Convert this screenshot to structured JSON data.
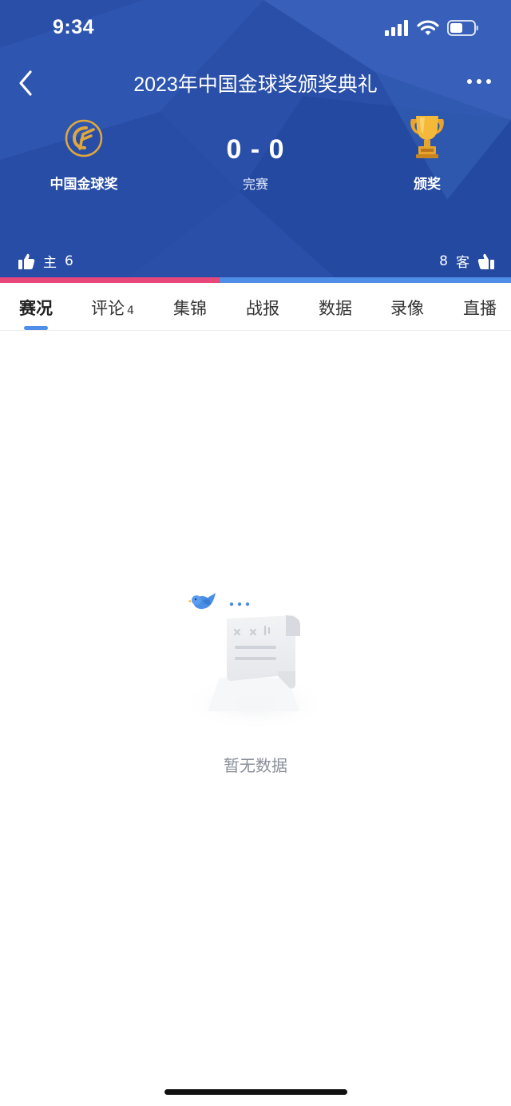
{
  "status_bar": {
    "time": "9:34"
  },
  "nav": {
    "title": "2023年中国金球奖颁奖典礼"
  },
  "match": {
    "home_team": "中国金球奖",
    "away_team": "颁奖",
    "score": "0 - 0",
    "status": "完赛"
  },
  "support": {
    "home_label": "主",
    "home_count": "6",
    "away_label": "客",
    "away_count": "8",
    "home_share": 0.43
  },
  "tabs": [
    {
      "label": "赛况",
      "active": true
    },
    {
      "label": "评论",
      "badge": "4"
    },
    {
      "label": "集锦"
    },
    {
      "label": "战报"
    },
    {
      "label": "数据"
    },
    {
      "label": "录像"
    },
    {
      "label": "直播"
    }
  ],
  "empty_state": {
    "text": "暂无数据"
  },
  "colors": {
    "header_bg": "#2a4fa8",
    "home_vote": "#e8477a",
    "away_vote": "#4e8ee8",
    "accent": "#4e8ee8"
  }
}
